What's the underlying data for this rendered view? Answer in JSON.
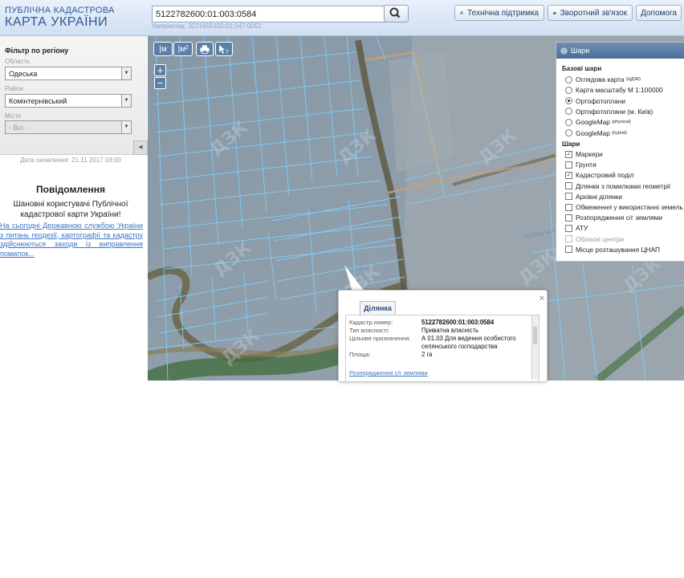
{
  "logo": {
    "line1": "ПУБЛІЧНА КАДАСТРОВА",
    "line2": "КАРТА УКРАЇНИ"
  },
  "search": {
    "value": "5122782600:01:003:0584",
    "hint": "Наприклад: 3221655100:01:047:0052"
  },
  "header_buttons": {
    "support": "Технічна підтримка",
    "feedback": "Зворотний зв'язок",
    "help": "Допомога"
  },
  "filter": {
    "title": "Фільтр по регіону",
    "region_label": "Область",
    "region_value": "Одеська",
    "district_label": "Район",
    "district_value": "Комінтернівський",
    "city_label": "Місто",
    "city_value": "- Всі -"
  },
  "updated": "Дата оновлення: 21.11.2017 03:00",
  "notice": {
    "title": "Повідомлення",
    "body": "Шановні користувачі Публічної кадастрової карти України!",
    "link": "На сьогодні Державною службою України з питань геодезії, картографії та кадастру здійснюються заходи із виправлення помилок..."
  },
  "map_tools": {
    "t1": "|м",
    "t2": "|м²",
    "zoom_in": "+",
    "zoom_out": "−"
  },
  "layers": {
    "title": "Шари",
    "base_title": "Базові шари",
    "base": [
      {
        "label": "Оглядова карта",
        "sup": "(ЦДЗК)",
        "on": false
      },
      {
        "label": "Карта масштабу М 1:100000",
        "sup": "",
        "on": false
      },
      {
        "label": "Ортофотоплани",
        "sup": "",
        "on": true
      },
      {
        "label": "Ортофотоплани (м. Київ)",
        "sup": "",
        "on": false
      },
      {
        "label": "GoogleMap",
        "sup": "(physical)",
        "on": false
      },
      {
        "label": "GoogleMap",
        "sup": "(hybrid)",
        "on": false
      }
    ],
    "overlay_title": "Шари",
    "overlays": [
      {
        "label": "Маркери",
        "on": true,
        "dim": false
      },
      {
        "label": "Грунти",
        "on": false,
        "dim": false
      },
      {
        "label": "Кадастровий поділ",
        "on": true,
        "dim": false
      },
      {
        "label": "Ділянки з помилками геометрії",
        "on": false,
        "dim": false
      },
      {
        "label": "Архівні ділянки",
        "on": false,
        "dim": false
      },
      {
        "label": "Обмеження у використанні земель",
        "on": false,
        "dim": false
      },
      {
        "label": "Розпорядження с/г землями",
        "on": false,
        "dim": false
      },
      {
        "label": "АТУ",
        "on": false,
        "dim": false
      },
      {
        "label": "Обласні центри",
        "on": false,
        "dim": true
      },
      {
        "label": "Місце розташування ЦНАП",
        "on": false,
        "dim": false
      }
    ]
  },
  "popup": {
    "tab": "Ділянка",
    "close": "×",
    "rows": [
      {
        "label": "Кадастр.номер:",
        "value": "5122782600:01:003:0584"
      },
      {
        "label": "Тип власності:",
        "value": "Приватна власність"
      },
      {
        "label": "Цільове призначення:",
        "value": "А 01.03 Для ведення особистого селянського господарства"
      },
      {
        "label": "Площа:",
        "value": "2 га"
      }
    ],
    "link": "Розпорядження с/г землями"
  },
  "watermark": "ДЗК",
  "colors": {
    "header_text": "#2b5a93",
    "parcel_lines": "#7fd0ff",
    "link": "#3b74c2"
  }
}
